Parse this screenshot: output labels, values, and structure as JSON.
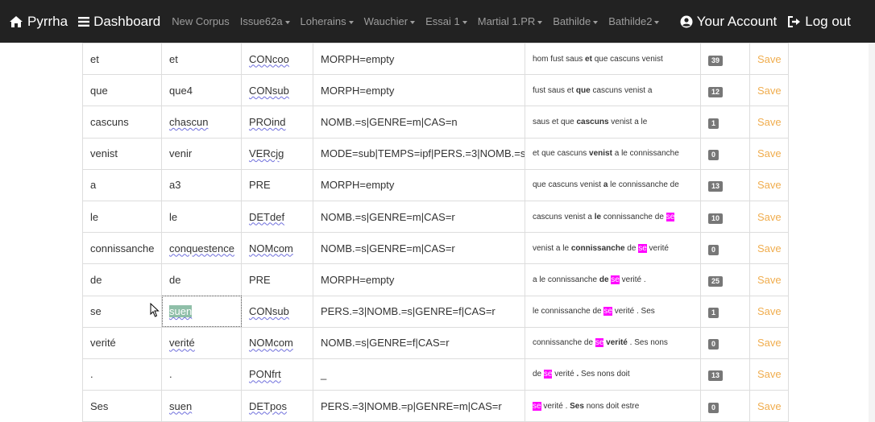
{
  "navbar": {
    "brand": "Pyrrha",
    "dashboard": "Dashboard",
    "links": [
      "New Corpus",
      "Issue62a",
      "Loherains",
      "Wauchier",
      "Essai 1",
      "Martial 1.PR",
      "Bathilde",
      "Bathilde2"
    ],
    "account": "Your Account",
    "logout": "Log out"
  },
  "rows": [
    {
      "form": "et",
      "lemma": "et",
      "pos": "CONcoo",
      "morph": "MORPH=empty",
      "ctx_pre": "hom fust saus ",
      "ctx_tok": "et",
      "ctx_post": " que cascuns venist",
      "count": "39",
      "save": "Save"
    },
    {
      "form": "que",
      "lemma": "que4",
      "pos": "CONsub",
      "morph": "MORPH=empty",
      "ctx_pre": "fust saus et ",
      "ctx_tok": "que",
      "ctx_post": " cascuns venist a",
      "count": "12",
      "save": "Save"
    },
    {
      "form": "cascuns",
      "lemma": "chascun",
      "pos": "PROind",
      "morph": "NOMB.=s|GENRE=m|CAS=n",
      "ctx_pre": "saus et que ",
      "ctx_tok": "cascuns",
      "ctx_post": " venist a le",
      "count": "1",
      "save": "Save"
    },
    {
      "form": "venist",
      "lemma": "venir",
      "pos": "VERcjg",
      "morph": "MODE=sub|TEMPS=ipf|PERS.=3|NOMB.=s",
      "ctx_pre": "et que cascuns ",
      "ctx_tok": "venist",
      "ctx_post": " a le connissanche",
      "count": "0",
      "save": "Save"
    },
    {
      "form": "a",
      "lemma": "a3",
      "pos": "PRE",
      "morph": "MORPH=empty",
      "ctx_pre": "que cascuns venist ",
      "ctx_tok": "a",
      "ctx_post": " le connissanche de",
      "count": "13",
      "save": "Save"
    },
    {
      "form": "le",
      "lemma": "le",
      "pos": "DETdef",
      "morph": "NOMB.=s|GENRE=m|CAS=r",
      "ctx_pre": "cascuns venist a ",
      "ctx_tok": "le",
      "ctx_post": " connissanche de ",
      "ctx_hl": "se",
      "count": "10",
      "save": "Save"
    },
    {
      "form": "connissanche",
      "lemma": "conquestence",
      "pos": "NOMcom",
      "morph": "NOMB.=s|GENRE=m|CAS=r",
      "ctx_pre": "venist a le ",
      "ctx_tok": "connissanche",
      "ctx_mid": " de ",
      "ctx_hl": "se",
      "ctx_post": " verité",
      "count": "0",
      "save": "Save"
    },
    {
      "form": "de",
      "lemma": "de",
      "pos": "PRE",
      "morph": "MORPH=empty",
      "ctx_pre": "a le connissanche ",
      "ctx_tok": "de",
      "ctx_mid": " ",
      "ctx_hl": "se",
      "ctx_post": " verité .",
      "count": "25",
      "save": "Save"
    },
    {
      "form": "se",
      "lemma": "suen",
      "pos": "CONsub",
      "morph": "PERS.=3|NOMB.=s|GENRE=f|CAS=r",
      "ctx_pre": "le connissanche de ",
      "ctx_hl": "se",
      "ctx_post": " verité . Ses",
      "count": "1",
      "save": "Save"
    },
    {
      "form": "verité",
      "lemma": "verité",
      "pos": "NOMcom",
      "morph": "NOMB.=s|GENRE=f|CAS=r",
      "ctx_pre": "connissanche de ",
      "ctx_hl": "se",
      "ctx_tok": " verité",
      "ctx_post": " . Ses nons",
      "count": "0",
      "save": "Save"
    },
    {
      "form": ".",
      "lemma": ".",
      "pos": "PONfrt",
      "morph": "_",
      "ctx_pre": "de ",
      "ctx_hl": "se",
      "ctx_mid": " verité ",
      "ctx_tok": ".",
      "ctx_post": " Ses nons doit",
      "count": "13",
      "save": "Save"
    },
    {
      "form": "Ses",
      "lemma": "suen",
      "pos": "DETpos",
      "morph": "PERS.=3|NOMB.=p|GENRE=m|CAS=r",
      "ctx_hl": "se",
      "ctx_mid": " verité . ",
      "ctx_tok": "Ses",
      "ctx_post": " nons doit estre",
      "count": "0",
      "save": "Save"
    }
  ]
}
